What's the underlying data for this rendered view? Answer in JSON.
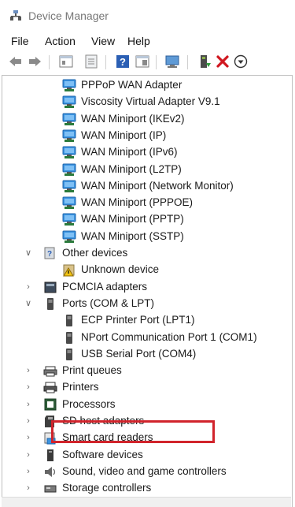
{
  "window": {
    "title": "Device Manager"
  },
  "menu": [
    "File",
    "Action",
    "View",
    "Help"
  ],
  "toolbar": [
    "back-arrow-icon",
    "forward-arrow-icon",
    "show-hide-console-tree-icon",
    "properties-icon",
    "help-icon",
    "view-icon",
    "scan-hardware-icon",
    "update-driver-icon",
    "uninstall-icon",
    "download-icon"
  ],
  "tree": {
    "network_adapters": [
      "PPPoP WAN Adapter",
      "Viscosity Virtual Adapter V9.1",
      "WAN Miniport (IKEv2)",
      "WAN Miniport (IP)",
      "WAN Miniport (IPv6)",
      "WAN Miniport (L2TP)",
      "WAN Miniport (Network Monitor)",
      "WAN Miniport (PPPOE)",
      "WAN Miniport (PPTP)",
      "WAN Miniport (SSTP)"
    ],
    "other_devices": {
      "label": "Other devices",
      "children": [
        "Unknown device"
      ]
    },
    "pcmcia": {
      "label": "PCMCIA adapters"
    },
    "ports": {
      "label": "Ports (COM & LPT)",
      "children": [
        "ECP Printer Port (LPT1)",
        "NPort Communication Port 1 (COM1)",
        "USB Serial Port (COM4)"
      ]
    },
    "categories_after": [
      "Print queues",
      "Printers",
      "Processors",
      "SD host adapters",
      "Smart card readers",
      "Software devices",
      "Sound, video and game controllers",
      "Storage controllers"
    ]
  },
  "colors": {
    "highlight": "#d1242c",
    "network_icon": "#2f8ad8"
  }
}
